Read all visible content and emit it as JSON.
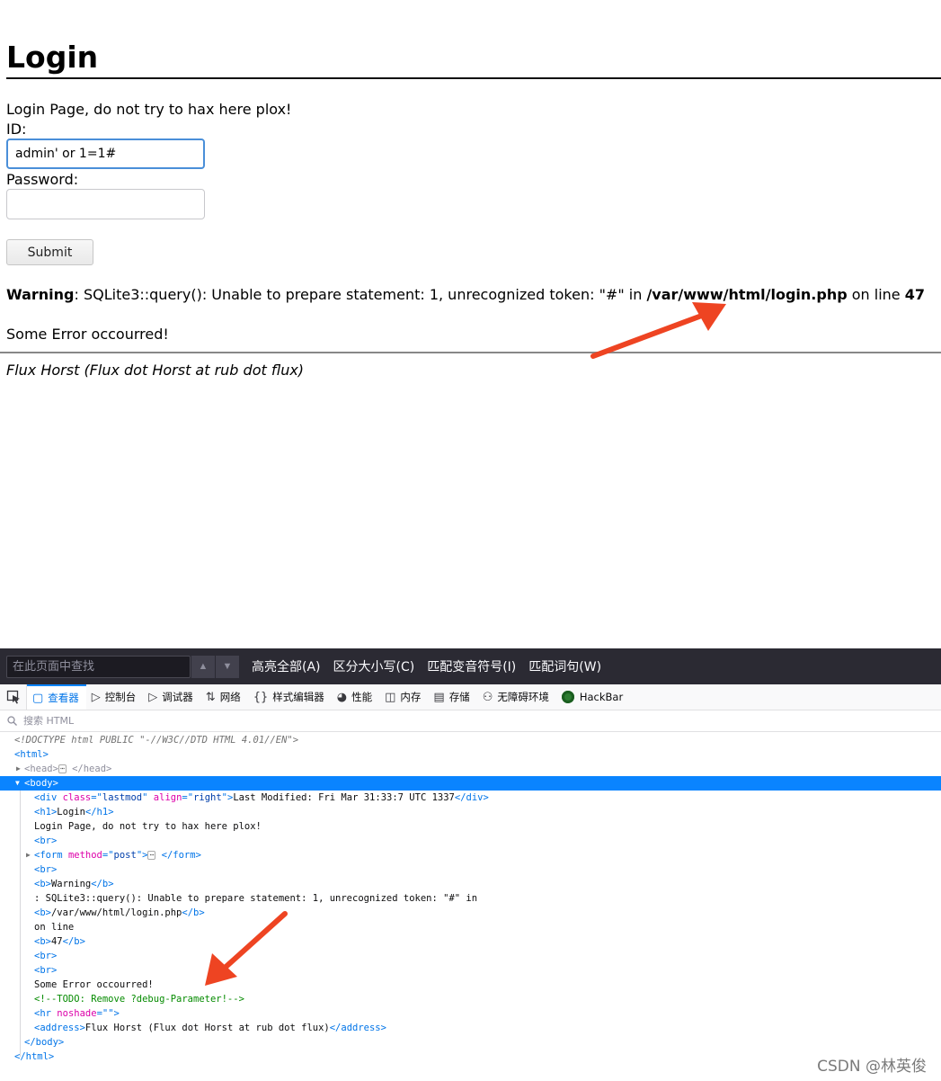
{
  "page": {
    "title": "Login",
    "intro": "Login Page, do not try to hax here plox!",
    "id_label": "ID:",
    "id_value": "admin' or 1=1#",
    "password_label": "Password:",
    "password_value": "",
    "submit_label": "Submit",
    "warning": {
      "label": "Warning",
      "message": ": SQLite3::query(): Unable to prepare statement: 1, unrecognized token: \"#\" in ",
      "path": "/var/www/html/login.php",
      "on_line": " on line ",
      "line": "47"
    },
    "error_text": "Some Error occourred!",
    "address": "Flux Horst (Flux dot Horst at rub dot flux)"
  },
  "findbar": {
    "placeholder": "在此页面中查找",
    "highlight_all": "高亮全部(A)",
    "match_case": "区分大小写(C)",
    "match_diacritics": "匹配变音符号(I)",
    "whole_words": "匹配词句(W)"
  },
  "devtools": {
    "tabs": [
      {
        "label": "查看器",
        "icon": "inspector-icon"
      },
      {
        "label": "控制台",
        "icon": "console-icon"
      },
      {
        "label": "调试器",
        "icon": "debugger-icon"
      },
      {
        "label": "网络",
        "icon": "network-icon"
      },
      {
        "label": "样式编辑器",
        "icon": "style-editor-icon"
      },
      {
        "label": "性能",
        "icon": "performance-icon"
      },
      {
        "label": "内存",
        "icon": "memory-icon"
      },
      {
        "label": "存储",
        "icon": "storage-icon"
      },
      {
        "label": "无障碍环境",
        "icon": "accessibility-icon"
      },
      {
        "label": "HackBar",
        "icon": "hackbar-icon"
      }
    ],
    "search_placeholder": "搜索 HTML",
    "tree": {
      "doctype": "<!DOCTYPE html PUBLIC \"-//W3C//DTD HTML 4.01//EN\">",
      "lastmod_text": "Last Modified: Fri Mar 31:33:7 UTC 1337",
      "h1_text": "Login",
      "intro_text": "Login Page, do not try to hax here plox!",
      "warning_text": "Warning",
      "warning_msg": ": SQLite3::query(): Unable to prepare statement: 1, unrecognized token: \"#\" in",
      "path_text": "/var/www/html/login.php",
      "on_line_text": "on line",
      "line_text": "47",
      "error_text": "Some Error occourred!",
      "comment": "<!--TODO: Remove ?debug-Parameter!-->",
      "address_text": "Flux Horst (Flux dot Horst at rub dot flux)"
    }
  },
  "colors": {
    "selection": "#0a84ff",
    "tag": "#0074e8",
    "attribute": "#dd00a9",
    "value": "#003eaa",
    "comment": "#058b00",
    "arrow": "#ee4422",
    "findbar_bg": "#2b2a33"
  },
  "watermark": "CSDN @林英俊"
}
